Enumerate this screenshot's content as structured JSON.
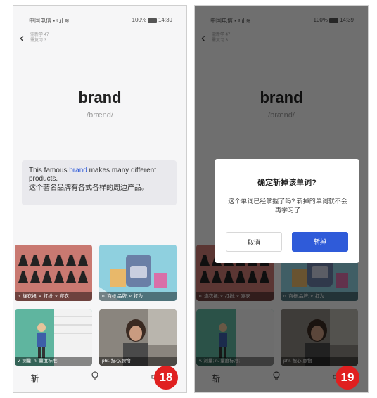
{
  "status_bar": {
    "carrier": "中国电信",
    "battery": "100%",
    "time": "14:39"
  },
  "progress": {
    "line1": "需新学 47",
    "line2": "需复习 3"
  },
  "word": "brand",
  "phonetic": "/brænd/",
  "example": {
    "pre": "This famous ",
    "highlight": "brand",
    "post": " makes many different products.",
    "translation": "这个著名品牌有各式各样的周边产品。"
  },
  "cards": [
    {
      "caption": "n. 连衣裙;    v. 打扮;    v. 穿衣"
    },
    {
      "caption": "n. 商标,品牌;    v. 打为"
    },
    {
      "caption": "v. 测量;    n. 量度标准;"
    },
    {
      "caption": "phr. 担心,顾物"
    }
  ],
  "bottom_bar": {
    "slash_icon": "斩",
    "bulb_icon": "lightbulb-icon",
    "speaker_icon": "speaker-icon"
  },
  "badges": {
    "left": "18",
    "right": "19"
  },
  "dialog": {
    "title": "确定斩掉该单词?",
    "message": "这个单词已经掌握了吗? 斩掉的单词就不会再学习了",
    "cancel": "取消",
    "confirm": "斩掉"
  },
  "colors": {
    "accent": "#2f5bd9",
    "badge": "#e02020"
  }
}
